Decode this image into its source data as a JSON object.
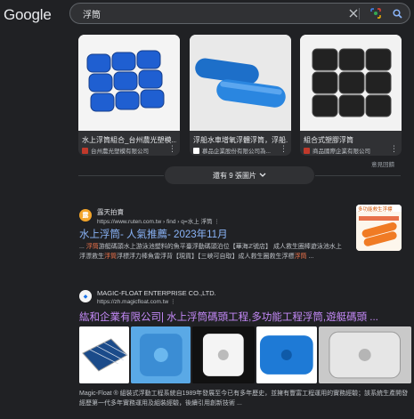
{
  "app": {
    "logo": "Google"
  },
  "search": {
    "query": "浮筒"
  },
  "image_cards": [
    {
      "title": "水上浮筒組合_台州農光塑模...",
      "source": "台州農光塑模有限公司",
      "fav_color": "#c0392b"
    },
    {
      "title": "浮船水車增氧浮體浮筒，浮船...",
      "source": "慕品企業股份有限公司為...",
      "fav_color": "#ffffff"
    },
    {
      "title": "組合式塑膠浮筒",
      "source": "商品國際企業有限公司",
      "fav_color": "#c0392b"
    }
  ],
  "feedback": "意見回饋",
  "more_images": "還有 9 張圖片",
  "results": [
    {
      "site": "露天拍賣",
      "url": "https://www.ruten.com.tw › find › q=水上 浮筒",
      "title": "水上浮筒- 人氣推薦- 2023年11月",
      "snippet_html": "... 浮筒游艇碼頭水上游泳池塑料的魚平臺浮動碼頭泊位【華海ℤ號店】 成人救生圈棒遊泳池水上浮漂救生浮筒浮標浮力棒魚雷浮背【現貨】【三峽可自取】成人救生圈救生浮標浮筒 ...",
      "thumb_label": "多功能救生浮標"
    },
    {
      "site": "MAGIC-FLOAT ENTERPRISE CO.,LTD.",
      "url": "https://zh.magicfloat.com.tw",
      "title": "紘和企業有限公司| 水上浮筒碼頭工程,多功能工程浮筒,遊艇碼頭 ...",
      "snippet": "Magic-Float ® 組裝式浮動工程系統自1989年發展至今已有多年歷史，並擁有豐富工程運用的實務經驗；該系統生產開發經歷第一代多年實務運用及組裝經驗，後續引用創新技術 ..."
    }
  ],
  "colors": {
    "accent_link": "#8ab4f8",
    "visited_link": "#c58af9",
    "highlight": "#e8714a",
    "background": "#202124"
  },
  "icons": [
    "google-g-icon",
    "clear-icon",
    "lens-icon",
    "search-icon",
    "chevron-down-icon",
    "more-vert-icon"
  ]
}
